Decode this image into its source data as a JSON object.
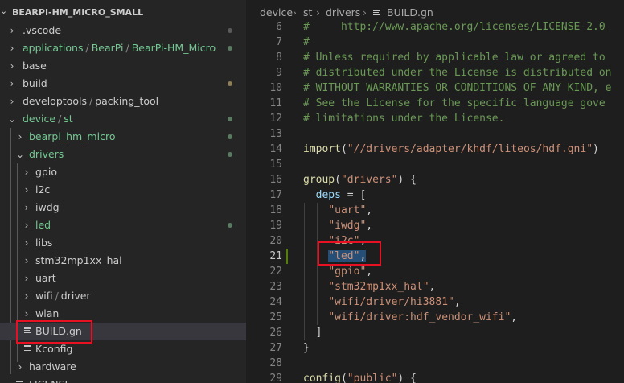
{
  "explorer": {
    "title": "BEARPI-HM_MICRO_SMALL",
    "items": [
      {
        "label": ".vscode"
      },
      {
        "parts": [
          "applications",
          "BearPi",
          "BearPi-HM_Micro"
        ]
      },
      {
        "label": "base"
      },
      {
        "label": "build"
      },
      {
        "parts": [
          "developtools",
          "packing_tool"
        ]
      },
      {
        "parts": [
          "device",
          "st"
        ]
      },
      {
        "label": "bearpi_hm_micro"
      },
      {
        "label": "drivers"
      },
      {
        "label": "gpio"
      },
      {
        "label": "i2c"
      },
      {
        "label": "iwdg"
      },
      {
        "label": "led"
      },
      {
        "label": "libs"
      },
      {
        "label": "stm32mp1xx_hal"
      },
      {
        "label": "uart"
      },
      {
        "parts": [
          "wifi",
          "driver"
        ]
      },
      {
        "label": "wlan"
      },
      {
        "label": "BUILD.gn"
      },
      {
        "label": "Kconfig"
      },
      {
        "label": "hardware"
      },
      {
        "label": "LICENSE"
      }
    ]
  },
  "breadcrumb": [
    "device",
    "st",
    "drivers",
    "BUILD.gn"
  ],
  "editor": {
    "active_line": "21",
    "lines": [
      {
        "n": "6",
        "tokens": [
          {
            "t": "#     ",
            "k": "c"
          },
          {
            "t": "http://www.apache.org/licenses/LICENSE-2.0",
            "k": "c u"
          }
        ]
      },
      {
        "n": "7",
        "tokens": [
          {
            "t": "#",
            "k": "c"
          }
        ]
      },
      {
        "n": "8",
        "tokens": [
          {
            "t": "# Unless required by applicable law or agreed to",
            "k": "c"
          }
        ]
      },
      {
        "n": "9",
        "tokens": [
          {
            "t": "# distributed under the License is distributed on",
            "k": "c"
          }
        ]
      },
      {
        "n": "10",
        "tokens": [
          {
            "t": "# WITHOUT WARRANTIES OR CONDITIONS OF ANY KIND, e",
            "k": "c"
          }
        ]
      },
      {
        "n": "11",
        "tokens": [
          {
            "t": "# See the License for the specific language gove",
            "k": "c"
          }
        ]
      },
      {
        "n": "12",
        "tokens": [
          {
            "t": "# limitations under the License.",
            "k": "c"
          }
        ]
      },
      {
        "n": "13",
        "tokens": []
      },
      {
        "n": "14",
        "tokens": [
          {
            "t": "import",
            "k": "f"
          },
          {
            "t": "(",
            "k": "p"
          },
          {
            "t": "\"//drivers/adapter/khdf/liteos/hdf.gni\"",
            "k": "s"
          },
          {
            "t": ")",
            "k": "p"
          }
        ]
      },
      {
        "n": "15",
        "tokens": []
      },
      {
        "n": "16",
        "tokens": [
          {
            "t": "group",
            "k": "f"
          },
          {
            "t": "(",
            "k": "p"
          },
          {
            "t": "\"drivers\"",
            "k": "s"
          },
          {
            "t": ") {",
            "k": "p"
          }
        ]
      },
      {
        "n": "17",
        "tokens": [
          {
            "t": "  ",
            "k": "p"
          },
          {
            "t": "deps",
            "k": "v"
          },
          {
            "t": " = [",
            "k": "p"
          }
        ]
      },
      {
        "n": "18",
        "tokens": [
          {
            "t": "    ",
            "k": "p"
          },
          {
            "t": "\"uart\"",
            "k": "s"
          },
          {
            "t": ",",
            "k": "p"
          }
        ]
      },
      {
        "n": "19",
        "tokens": [
          {
            "t": "    ",
            "k": "p"
          },
          {
            "t": "\"iwdg\"",
            "k": "s"
          },
          {
            "t": ",",
            "k": "p"
          }
        ]
      },
      {
        "n": "20",
        "tokens": [
          {
            "t": "    ",
            "k": "p"
          },
          {
            "t": "\"i2c\"",
            "k": "s"
          },
          {
            "t": ",",
            "k": "p"
          }
        ]
      },
      {
        "n": "21",
        "tokens": [
          {
            "t": "    ",
            "k": "p"
          },
          {
            "t": "\"led\"",
            "k": "s sel"
          },
          {
            "t": ",",
            "k": "p sel"
          }
        ]
      },
      {
        "n": "22",
        "tokens": [
          {
            "t": "    ",
            "k": "p"
          },
          {
            "t": "\"gpio\"",
            "k": "s"
          },
          {
            "t": ",",
            "k": "p"
          }
        ]
      },
      {
        "n": "23",
        "tokens": [
          {
            "t": "    ",
            "k": "p"
          },
          {
            "t": "\"stm32mp1xx_hal\"",
            "k": "s"
          },
          {
            "t": ",",
            "k": "p"
          }
        ]
      },
      {
        "n": "24",
        "tokens": [
          {
            "t": "    ",
            "k": "p"
          },
          {
            "t": "\"wifi/driver/hi3881\"",
            "k": "s"
          },
          {
            "t": ",",
            "k": "p"
          }
        ]
      },
      {
        "n": "25",
        "tokens": [
          {
            "t": "    ",
            "k": "p"
          },
          {
            "t": "\"wifi/driver:hdf_vendor_wifi\"",
            "k": "s"
          },
          {
            "t": ",",
            "k": "p"
          }
        ]
      },
      {
        "n": "26",
        "tokens": [
          {
            "t": "  ]",
            "k": "p"
          }
        ]
      },
      {
        "n": "27",
        "tokens": [
          {
            "t": "}",
            "k": "p"
          }
        ]
      },
      {
        "n": "28",
        "tokens": []
      },
      {
        "n": "29",
        "tokens": [
          {
            "t": "config",
            "k": "f"
          },
          {
            "t": "(",
            "k": "p"
          },
          {
            "t": "\"public\"",
            "k": "s"
          },
          {
            "t": ") {",
            "k": "p"
          }
        ]
      }
    ]
  },
  "colors": {
    "git_untracked": "#73c991",
    "git_modified": "#c9b674",
    "annotation": "#e81123"
  },
  "icons": [
    "chevron-down-icon",
    "chevron-right-icon",
    "file-lines-icon"
  ]
}
